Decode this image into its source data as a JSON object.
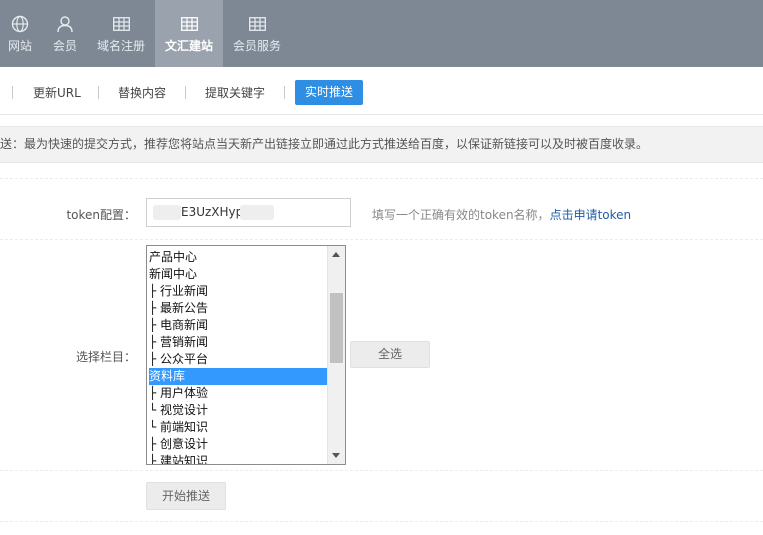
{
  "nav": {
    "items": [
      {
        "label": "网站",
        "icon": "globe-icon"
      },
      {
        "label": "会员",
        "icon": "user-icon"
      },
      {
        "label": "域名注册",
        "icon": "grid-icon"
      },
      {
        "label": "文汇建站",
        "icon": "grid-icon"
      },
      {
        "label": "会员服务",
        "icon": "grid-icon"
      }
    ],
    "active_index": 3
  },
  "tabs": {
    "items": [
      "更新URL",
      "替换内容",
      "提取关键字"
    ],
    "active_label": "实时推送"
  },
  "notice": "送：最为快速的提交方式，推荐您将站点当天新产出链接立即通过此方式推送给百度，以保证新链接可以及时被百度收录。",
  "form": {
    "token_label": "token配置：",
    "token_value": "E3UzXHyp",
    "token_hint": "填写一个正确有效的token名称，",
    "token_link": "点击申请token",
    "category_label": "选择栏目：",
    "categories": [
      "产品中心",
      "新闻中心",
      " ├ 行业新闻",
      " ├ 最新公告",
      " ├ 电商新闻",
      " ├ 营销新闻",
      " ├ 公众平台",
      "资料库",
      " ├ 用户体验",
      " └ 视觉设计",
      " └ 前端知识",
      " ├ 创意设计",
      " ├ 建站知识"
    ],
    "selected_category": "资料库",
    "select_all_label": "全选",
    "start_label": "开始推送"
  },
  "colors": {
    "nav_bg": "#7d8894",
    "nav_active": "#99a2ad",
    "accent": "#2e8ee3",
    "selection": "#3399ff"
  }
}
